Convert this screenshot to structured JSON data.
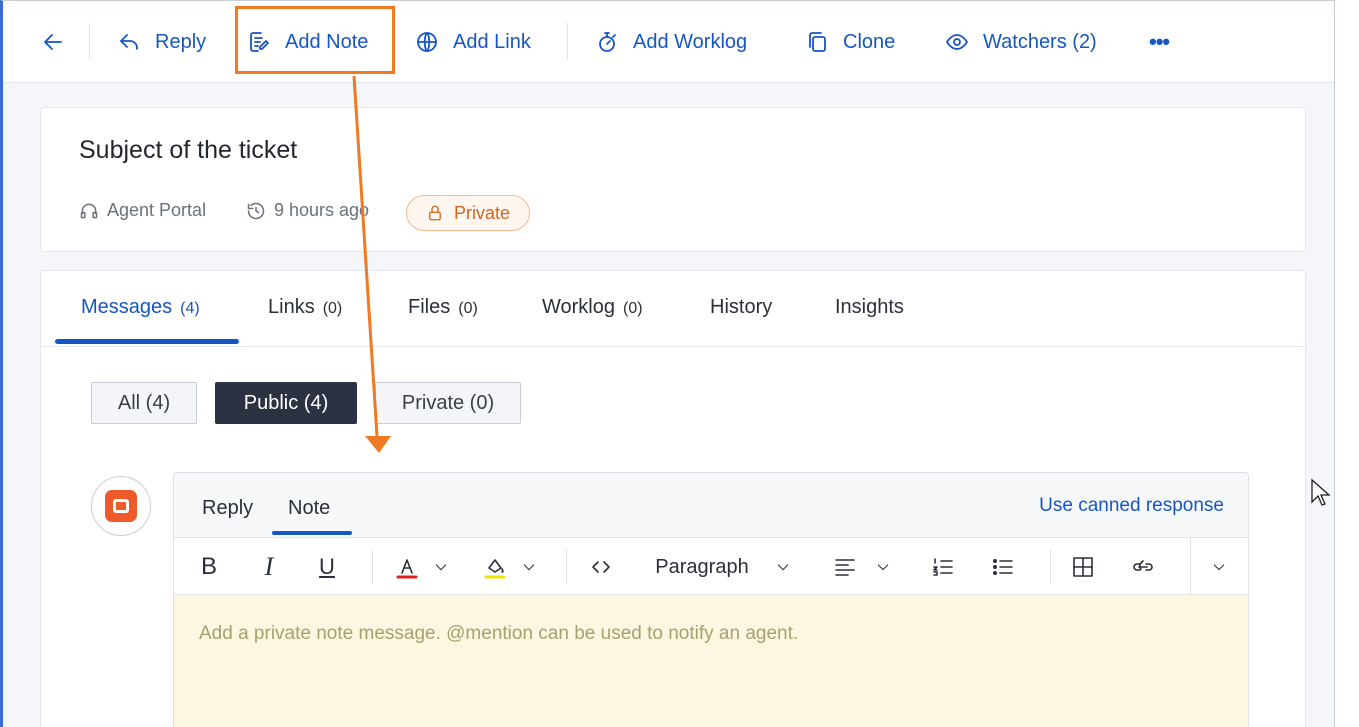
{
  "toolbar": {
    "back_label": "",
    "reply_label": "Reply",
    "add_note_label": "Add Note",
    "add_link_label": "Add Link",
    "add_worklog_label": "Add Worklog",
    "clone_label": "Clone",
    "watchers_label": "Watchers (2)",
    "more_label": "•••"
  },
  "ticket": {
    "subject": "Subject of the ticket",
    "source": "Agent Portal",
    "time_ago": "9 hours ago",
    "visibility_badge": "Private"
  },
  "tabs": [
    {
      "label": "Messages",
      "count": "(4)"
    },
    {
      "label": "Links",
      "count": "(0)"
    },
    {
      "label": "Files",
      "count": "(0)"
    },
    {
      "label": "Worklog",
      "count": "(0)"
    },
    {
      "label": "History",
      "count": ""
    },
    {
      "label": "Insights",
      "count": ""
    }
  ],
  "filters": [
    "All (4)",
    "Public (4)",
    "Private (0)"
  ],
  "editor": {
    "tabs": [
      "Reply",
      "Note"
    ],
    "canned_response_label": "Use canned response",
    "paragraph_label": "Paragraph",
    "placeholder": "Add a private note message. @mention can be used to notify an agent."
  },
  "colors": {
    "accent": "#1656c4",
    "highlight": "#f07a22",
    "note_background": "#fdf6e1",
    "private_badge": "#d06522"
  },
  "icons": [
    "back-arrow-icon",
    "reply-icon",
    "note-icon",
    "globe-icon",
    "stopwatch-icon",
    "clone-icon",
    "eye-icon",
    "more-icon",
    "headset-icon",
    "history-icon",
    "lock-icon",
    "bold-icon",
    "italic-icon",
    "underline-icon",
    "text-color-icon",
    "fill-color-icon",
    "code-icon",
    "align-icon",
    "numbered-list-icon",
    "bullet-list-icon",
    "table-icon",
    "link-icon",
    "chevron-down-icon"
  ]
}
